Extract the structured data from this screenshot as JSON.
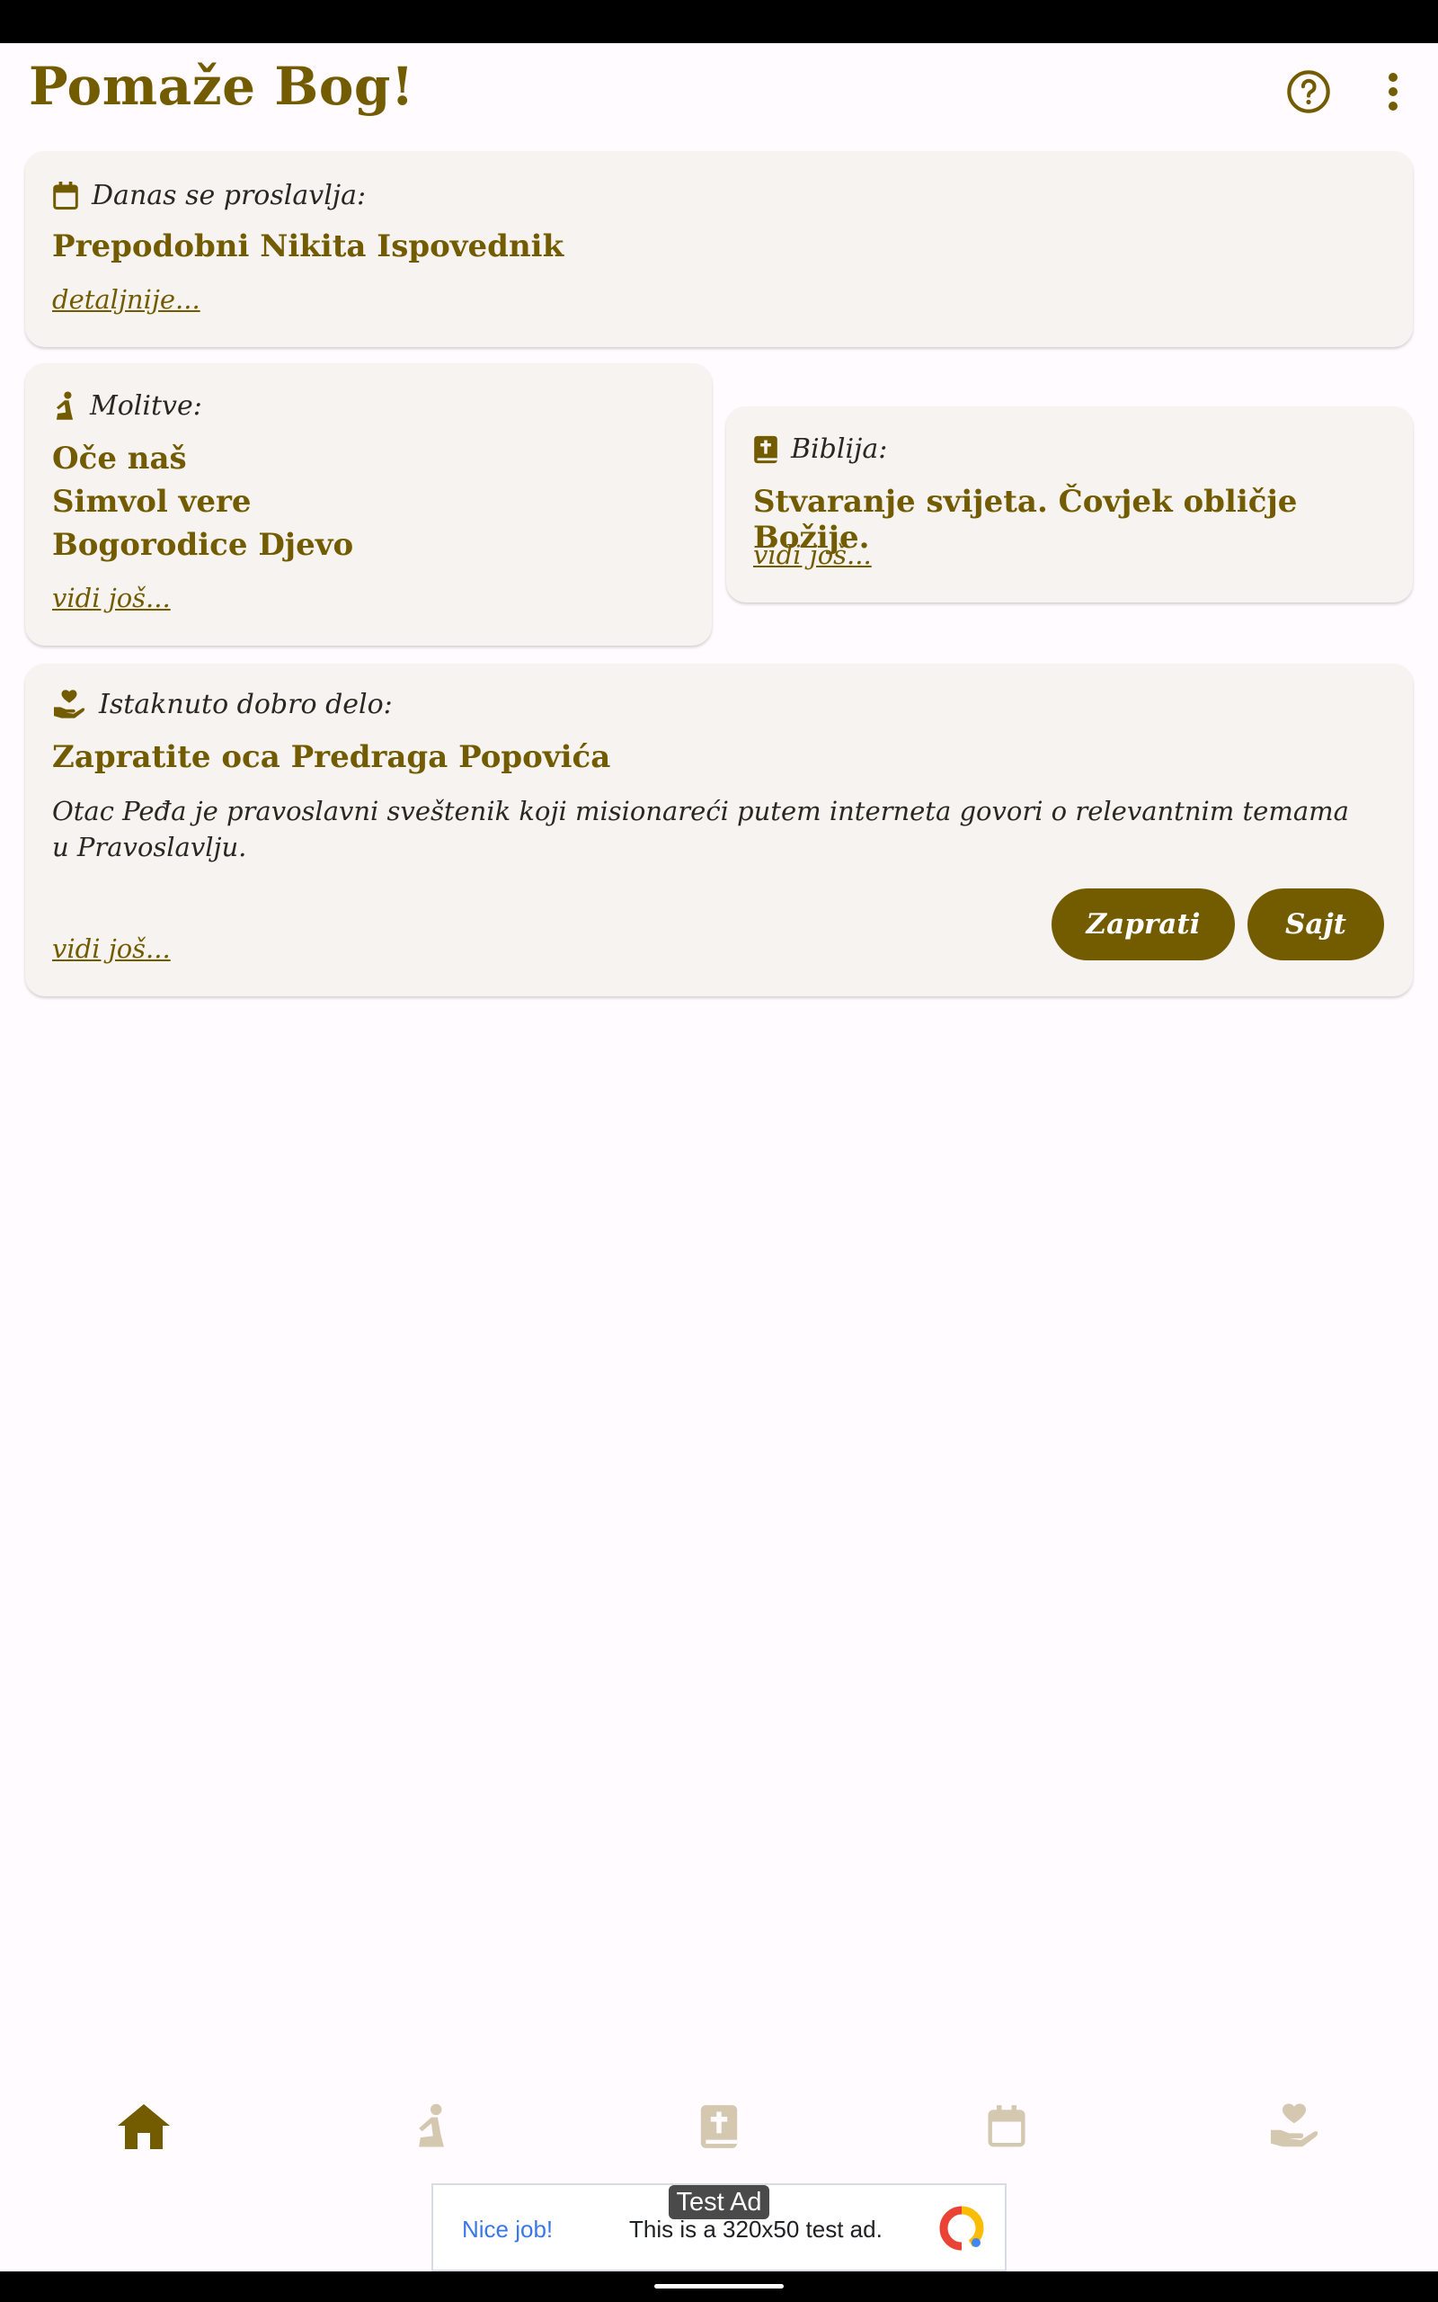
{
  "app": {
    "title": "Pomaže Bog!"
  },
  "header_icons": {
    "help": "help-circle-icon",
    "more": "more-vert-icon"
  },
  "colors": {
    "accent": "#735c00",
    "card_bg": "#f6f3f0",
    "page_bg": "#fffbfe",
    "nav_inactive": "#d4c9b0"
  },
  "feast_card": {
    "label": "Danas se proslavlja:",
    "title": "Prepodobni Nikita Ispovednik",
    "link": "detaljnije..."
  },
  "prayers_card": {
    "label": "Molitve:",
    "items": [
      "Oče naš",
      "Simvol vere",
      "Bogorodice Djevo"
    ],
    "link": "vidi još..."
  },
  "bible_card": {
    "label": "Biblija:",
    "title": "Stvaranje svijeta. Čovjek obličje Božije.",
    "link": "vidi još..."
  },
  "good_deed_card": {
    "label": "Istaknuto dobro delo:",
    "title": "Zapratite oca Predraga Popovića",
    "description": "Otac Peđa je pravoslavni sveštenik koji misionareći putem interneta govori o relevantnim temama u Pravoslavlju.",
    "link": "vidi još...",
    "follow_button": "Zaprati",
    "site_button": "Sajt"
  },
  "bottom_nav": [
    {
      "icon": "home-icon",
      "active": true
    },
    {
      "icon": "praying-icon",
      "active": false
    },
    {
      "icon": "bible-icon",
      "active": false
    },
    {
      "icon": "calendar-icon",
      "active": false
    },
    {
      "icon": "charity-hand-heart-icon",
      "active": false
    }
  ],
  "ad": {
    "tag": "Test Ad",
    "nice": "Nice job!",
    "text": "This is a 320x50 test ad."
  }
}
